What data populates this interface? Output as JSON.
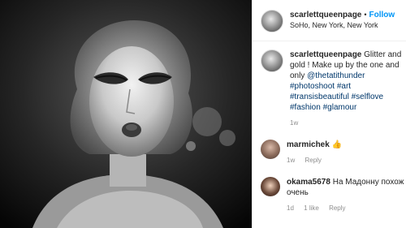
{
  "post": {
    "username": "scarlettqueenpage",
    "dot": "•",
    "follow_label": "Follow",
    "location": "SoHo, New York, New York"
  },
  "caption": {
    "username": "scarlettqueenpage",
    "text": "Glitter and gold !",
    "line2": "Make up by the one and only",
    "mention": "@thetatithunder",
    "hashtags1": "#photoshoot #art",
    "hashtags2": "#transisbeautiful #selflove #fashion",
    "hashtags3": "#glamour",
    "time": "1w"
  },
  "comments": [
    {
      "username": "marmichek",
      "text": "👍",
      "time": "1w",
      "reply": "Reply"
    },
    {
      "username": "okama5678",
      "text": "На Мадонну похож очень",
      "time": "1d",
      "likes": "1 like",
      "reply": "Reply"
    }
  ],
  "icons": {
    "photo": "portrait-photo",
    "avatar": "profile-avatar"
  }
}
